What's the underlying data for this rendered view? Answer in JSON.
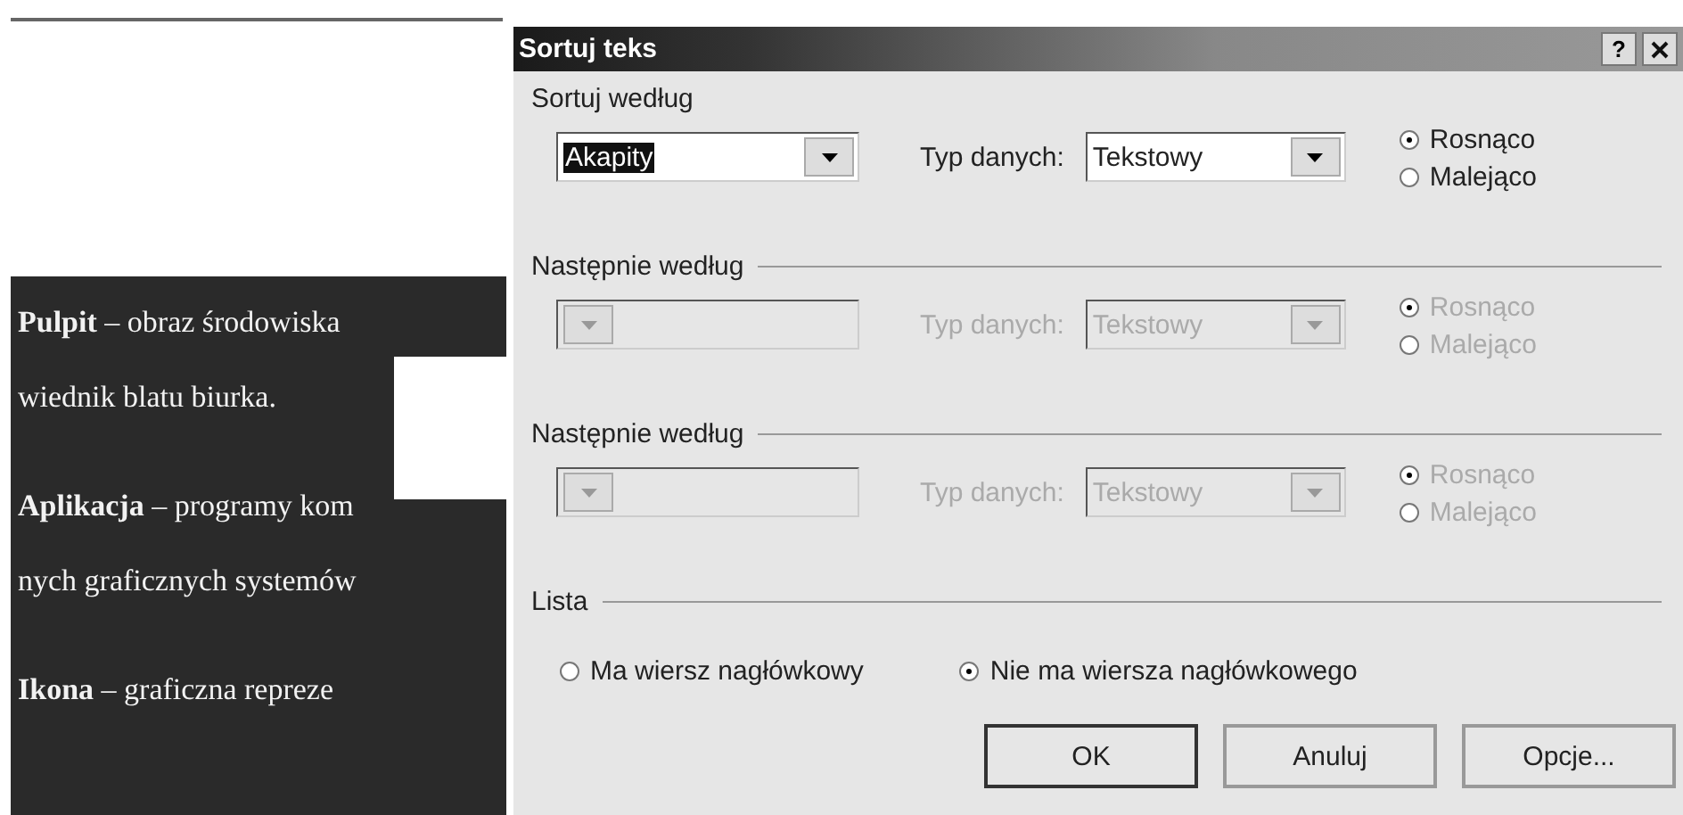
{
  "document": {
    "paragraphs": [
      {
        "lines": [
          "**Pulpit** – obraz środowiska",
          "wiednik blatu biurka."
        ]
      },
      {
        "lines": [
          "**Aplikacja** – programy kom",
          "nych graficznych systemów"
        ]
      },
      {
        "lines": [
          "**Ikona** – graficzna repreze"
        ]
      }
    ]
  },
  "window": {
    "title": "Sortuj teks",
    "help_button": "?"
  },
  "sort_groups": [
    {
      "label": "Sortuj według",
      "field": "Akapity",
      "field_highlighted": true,
      "type_label": "Typ danych:",
      "type_value": "Tekstowy",
      "disabled": false,
      "order": [
        {
          "label": "Rosnąco",
          "selected": true
        },
        {
          "label": "Malejąco",
          "selected": false
        }
      ]
    },
    {
      "label": "Następnie według",
      "type_label": "Typ danych:",
      "type_value": "Tekstowy",
      "disabled": true,
      "order": [
        {
          "label": "Rosnąco",
          "selected": true
        },
        {
          "label": "Malejąco",
          "selected": false
        }
      ]
    },
    {
      "label": "Następnie według",
      "type_label": "Typ danych:",
      "type_value": "Tekstowy",
      "disabled": true,
      "order": [
        {
          "label": "Rosnąco",
          "selected": true
        },
        {
          "label": "Malejąco",
          "selected": false
        }
      ]
    }
  ],
  "list": {
    "label": "Lista",
    "options": [
      {
        "label": "Ma wiersz nagłówkowy",
        "selected": false
      },
      {
        "label": "Nie ma wiersza nagłówkowego",
        "selected": true
      }
    ]
  },
  "buttons": [
    {
      "label": "OK",
      "default": true
    },
    {
      "label": "Anuluj",
      "default": false
    },
    {
      "label": "Opcje...",
      "default": false
    }
  ]
}
